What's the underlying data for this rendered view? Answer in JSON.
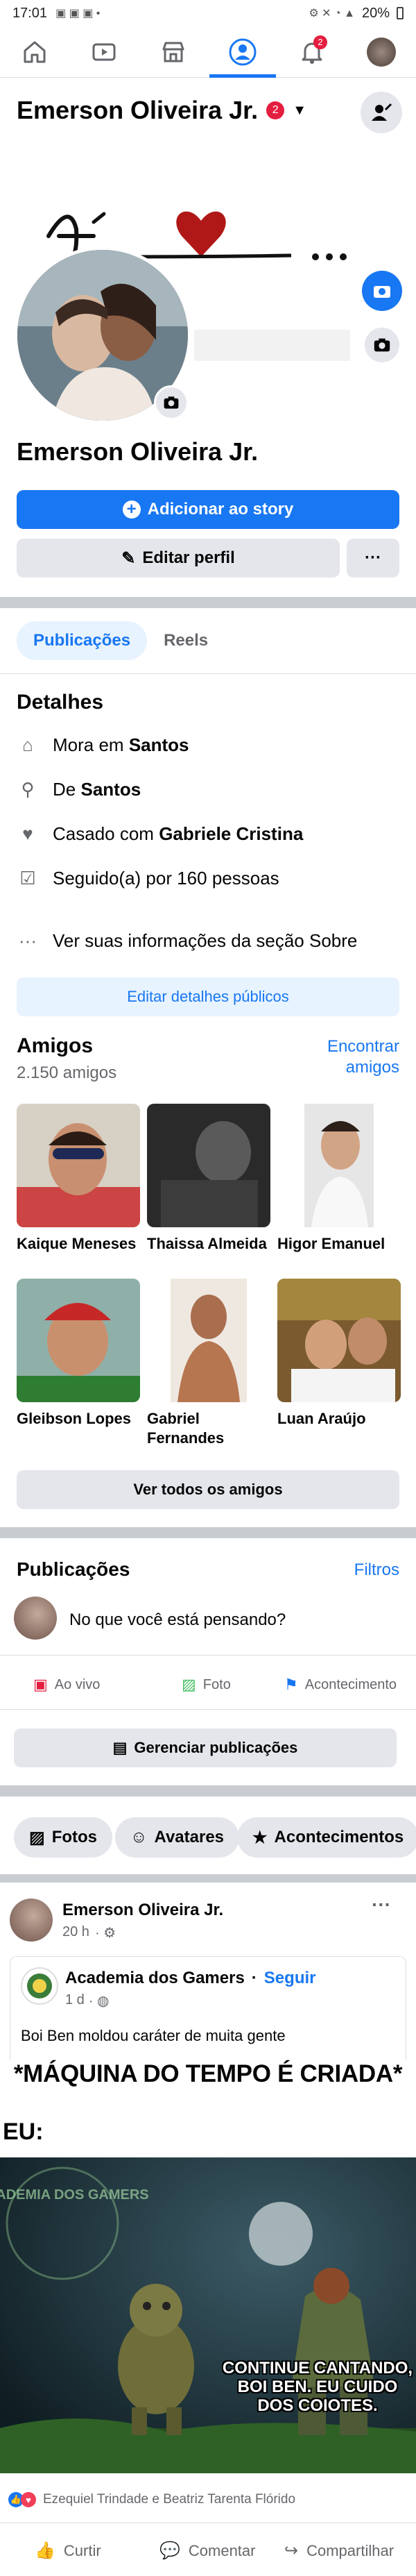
{
  "status_bar": {
    "time": "17:01",
    "battery": "20%"
  },
  "nav": {
    "notif_count": "2"
  },
  "header": {
    "name": "Emerson Oliveira Jr.",
    "badge_count": "2"
  },
  "profile": {
    "name": "Emerson Oliveira Jr.",
    "add_story": "Adicionar ao story",
    "edit_profile": "Editar perfil",
    "more": "···"
  },
  "tabs": {
    "posts": "Publicações",
    "reels": "Reels"
  },
  "details": {
    "title": "Detalhes",
    "lives_prefix": "Mora em",
    "lives_city": "Santos",
    "from_prefix": "De",
    "from_city": "Santos",
    "married_prefix": "Casado com",
    "married_name": "Gabriele Cristina",
    "followed": "Seguido(a) por 160 pessoas",
    "about": "Ver suas informações da seção Sobre",
    "edit_public": "Editar detalhes públicos"
  },
  "friends": {
    "title": "Amigos",
    "count": "2.150 amigos",
    "find": "Encontrar amigos",
    "items": [
      {
        "name": "Kaique Meneses"
      },
      {
        "name": "Thaissa Almeida"
      },
      {
        "name": "Higor Emanuel"
      },
      {
        "name": "Gleibson Lopes"
      },
      {
        "name": "Gabriel Fernandes"
      },
      {
        "name": "Luan Araújo"
      }
    ],
    "see_all": "Ver todos os amigos"
  },
  "publications": {
    "title": "Publicações",
    "filters": "Filtros",
    "composer_placeholder": "No que você está pensando?",
    "live": "Ao vivo",
    "photo": "Foto",
    "event": "Acontecimento",
    "manage": "Gerenciar publicações"
  },
  "chips": {
    "photos": "Fotos",
    "avatars": "Avatares",
    "events": "Acontecimentos"
  },
  "post": {
    "author": "Emerson Oliveira Jr.",
    "time": "20 h",
    "shared_page": "Academia dos Gamers",
    "follow": "Seguir",
    "shared_time": "1 d",
    "shared_text": "Boi Ben moldou caráter de muita gente",
    "meme_title": "*MÁQUINA DO TEMPO É CRIADA*",
    "meme_eu": "EU:",
    "meme_caption": "CONTINUE CANTANDO, BOI BEN. EU CUIDO DOS COIOTES.",
    "watermark": "ACADEMIA DOS GAMERS",
    "reactions": "Ezequiel Trindade e Beatriz Tarenta Flórido",
    "like": "Curtir",
    "comment": "Comentar",
    "share": "Compartilhar"
  },
  "colors": {
    "accent": "#1877f2",
    "badge": "#e41e3f",
    "divider": "#c9ccd1"
  }
}
